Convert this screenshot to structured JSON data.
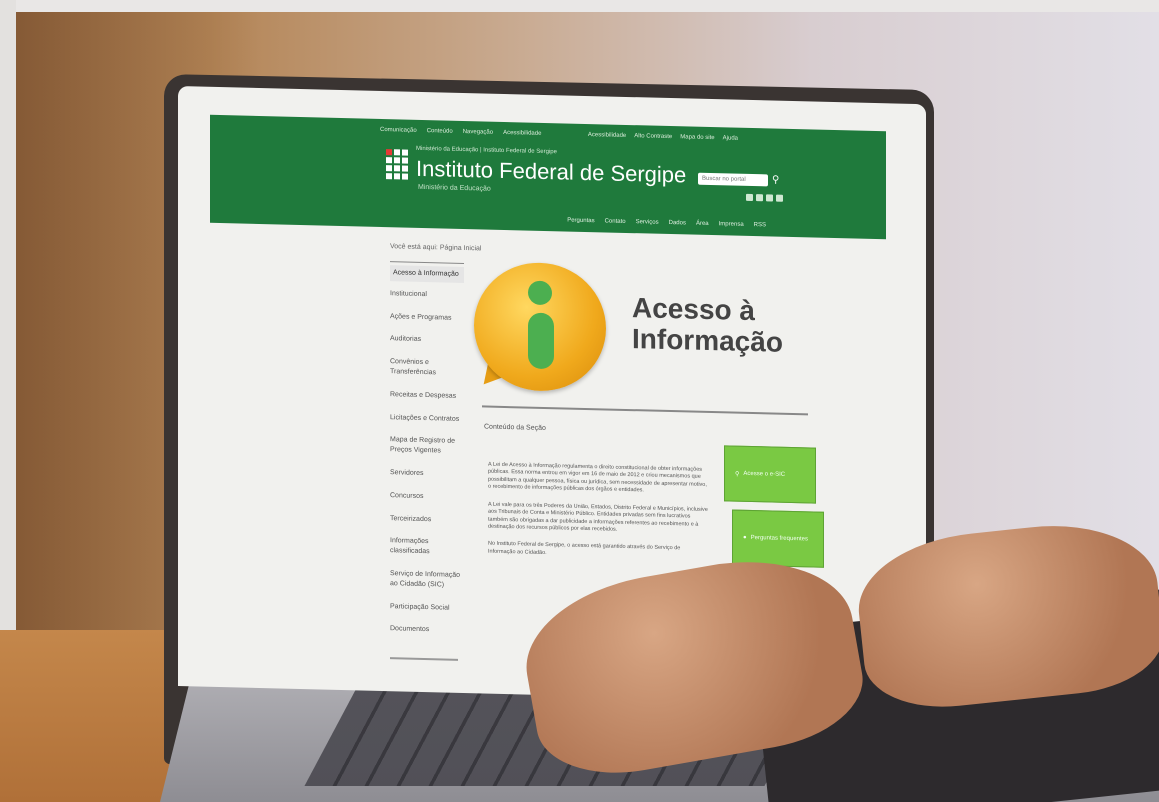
{
  "header": {
    "top_links_left": [
      "Comunicação",
      "Conteúdo",
      "Navegação",
      "Acessibilidade"
    ],
    "top_links_right": [
      "Acessibilidade",
      "Alto Contraste",
      "Mapa do site",
      "Ajuda"
    ],
    "subtitle": "Ministério da Educação | Instituto Federal de Sergipe",
    "title": "Instituto Federal de Sergipe",
    "tagline": "Ministério da Educação",
    "search_placeholder": "Buscar no portal",
    "menu": [
      "Perguntas",
      "Contato",
      "Serviços",
      "Dados",
      "Área",
      "Imprensa",
      "RSS"
    ]
  },
  "breadcrumb": "Você está aqui: Página Inicial",
  "sidebar": {
    "active": "Acesso à Informação",
    "items": [
      "Institucional",
      "Ações e Programas",
      "Auditorias",
      "Convênios e Transferências",
      "Receitas e Despesas",
      "Licitações e Contratos",
      "Mapa de Registro de Preços Vigentes",
      "Servidores",
      "Concursos",
      "Terceirizados",
      "Informações classificadas",
      "Serviço de Informação ao Cidadão (SIC)",
      "Participação Social",
      "Documentos"
    ]
  },
  "main": {
    "title": "Acesso à Informação",
    "section": "Conteúdo da Seção",
    "paragraphs": [
      "A Lei de Acesso à Informação regulamenta o direito constitucional de obter informações públicas. Essa norma entrou em vigor em 16 de maio de 2012 e criou mecanismos que possibilitam a qualquer pessoa, física ou jurídica, sem necessidade de apresentar motivo, o recebimento de informações públicas dos órgãos e entidades.",
      "A Lei vale para os três Poderes da União, Estados, Distrito Federal e Municípios, inclusive aos Tribunais de Conta e Ministério Público. Entidades privadas sem fins lucrativos também são obrigadas a dar publicidade a informações referentes ao recebimento e à destinação dos recursos públicos por elas recebidos.",
      "No Instituto Federal de Sergipe, o acesso está garantido através do Serviço de Informação ao Cidadão."
    ],
    "cta_primary": "Acesse o e-SIC",
    "cta_secondary": "Perguntas frequentes"
  },
  "colors": {
    "header_green": "#1f7a3c",
    "cta_green": "#7ac943",
    "info_orange": "#f0a91c"
  }
}
